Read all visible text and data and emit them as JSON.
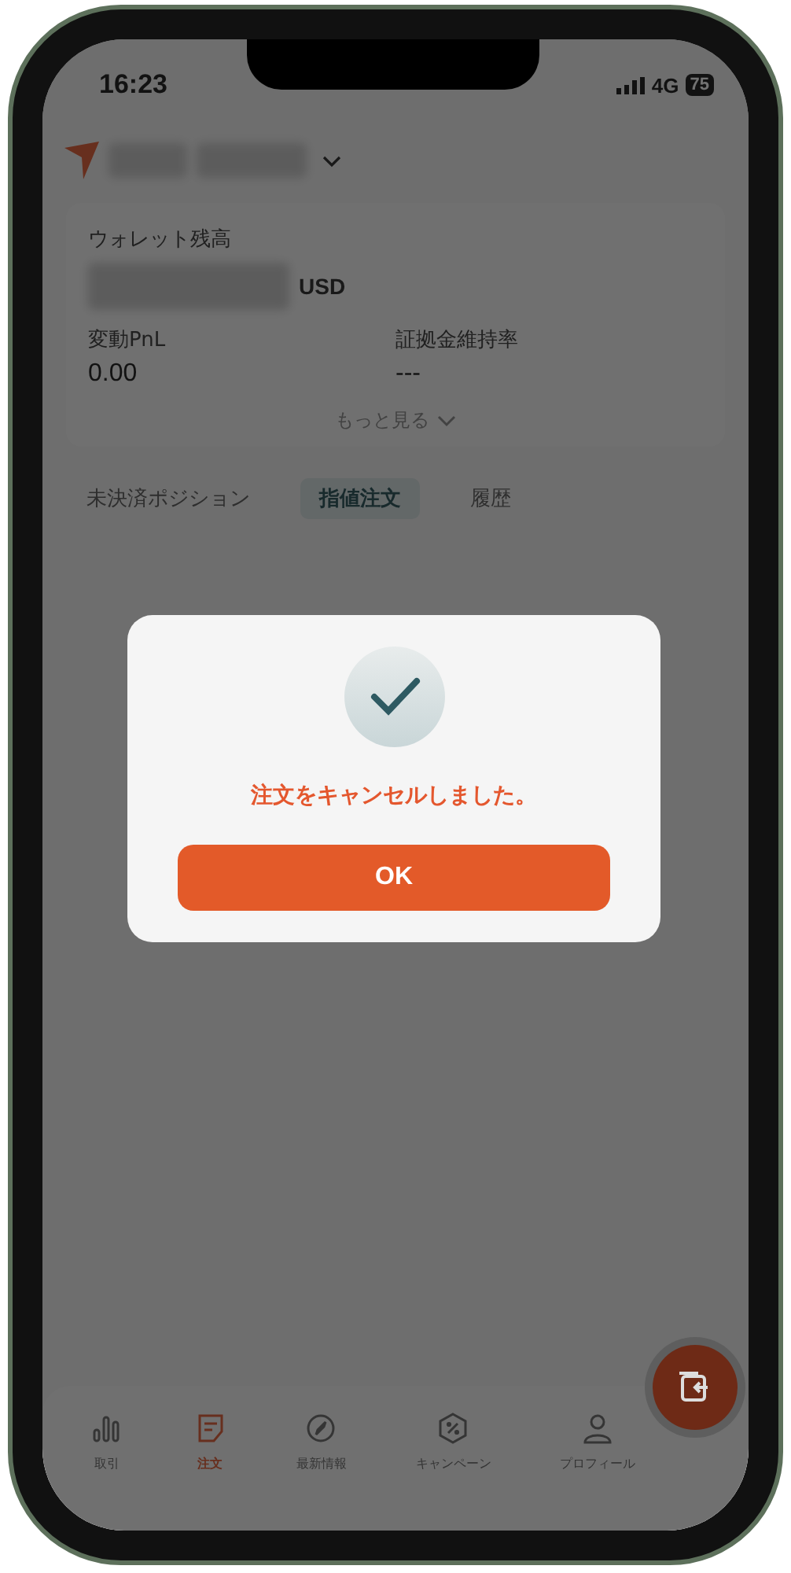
{
  "status_bar": {
    "time": "16:23",
    "network": "4G",
    "battery": "75"
  },
  "wallet": {
    "balance_label": "ウォレット残高",
    "currency": "USD",
    "stats": [
      {
        "label": "変動PnL",
        "value": "0.00"
      },
      {
        "label": "証拠金維持率",
        "value": "---"
      }
    ],
    "more": "もっと見る"
  },
  "tabs": [
    {
      "label": "未決済ポジション",
      "selected": false
    },
    {
      "label": "指値注文",
      "selected": true
    },
    {
      "label": "履歴",
      "selected": false
    }
  ],
  "nav": [
    {
      "label": "取引",
      "kind": "chart",
      "selected": false
    },
    {
      "label": "注文",
      "kind": "order",
      "selected": true
    },
    {
      "label": "最新情報",
      "kind": "compass",
      "selected": false
    },
    {
      "label": "キャンペーン",
      "kind": "coupon",
      "selected": false
    },
    {
      "label": "プロフィール",
      "kind": "person",
      "selected": false
    }
  ],
  "dialog": {
    "message": "注文をキャンセルしました。",
    "button": "OK"
  }
}
